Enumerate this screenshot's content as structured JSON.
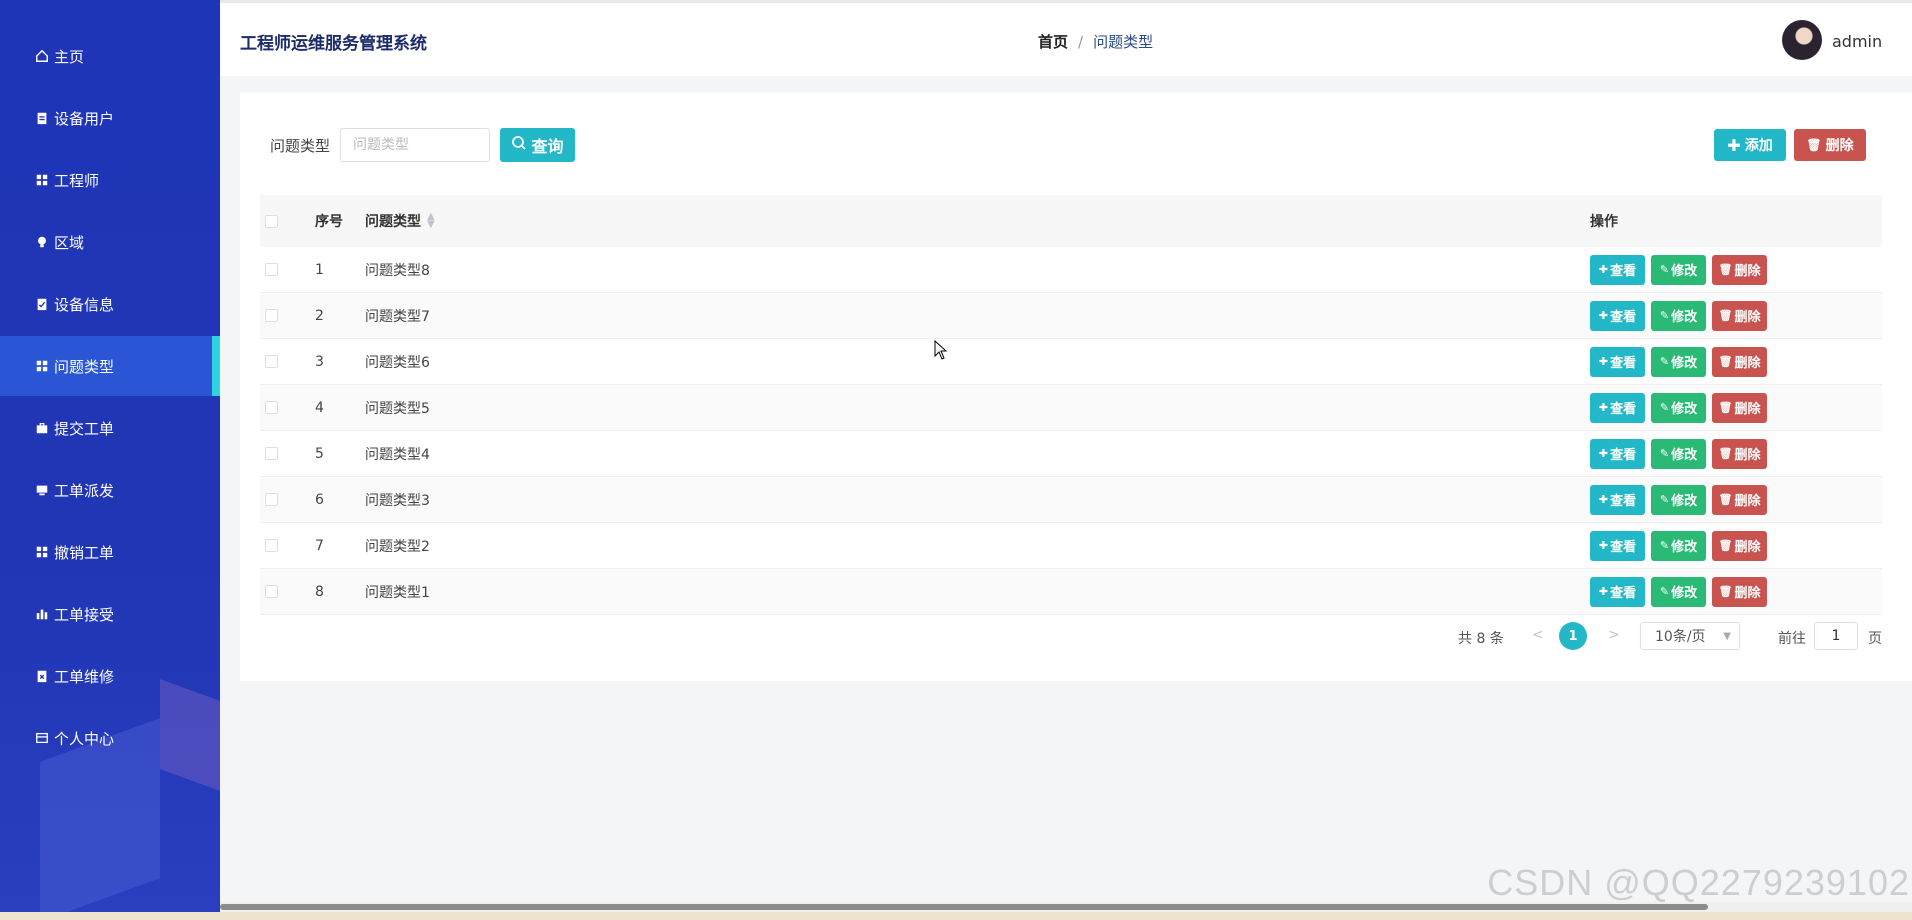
{
  "sidebar": {
    "items": [
      {
        "label": "主页",
        "icon": "home-icon"
      },
      {
        "label": "设备用户",
        "icon": "clipboard-icon"
      },
      {
        "label": "工程师",
        "icon": "grid-icon"
      },
      {
        "label": "区域",
        "icon": "lightbulb-icon"
      },
      {
        "label": "设备信息",
        "icon": "clipboard-check-icon"
      },
      {
        "label": "问题类型",
        "icon": "grid-icon",
        "active": true
      },
      {
        "label": "提交工单",
        "icon": "briefcase-icon"
      },
      {
        "label": "工单派发",
        "icon": "monitor-icon"
      },
      {
        "label": "撤销工单",
        "icon": "grid-icon"
      },
      {
        "label": "工单接受",
        "icon": "bar-chart-icon"
      },
      {
        "label": "工单维修",
        "icon": "clipboard-x-icon"
      },
      {
        "label": "个人中心",
        "icon": "card-icon"
      }
    ]
  },
  "header": {
    "app_title": "工程师运维服务管理系统",
    "breadcrumb_home": "首页",
    "breadcrumb_sep": "/",
    "breadcrumb_current": "问题类型",
    "username": "admin"
  },
  "search": {
    "label": "问题类型",
    "placeholder": "问题类型",
    "value": "",
    "query_label": "查询"
  },
  "toolbar": {
    "add_label": "添加",
    "delete_label": "删除"
  },
  "table": {
    "headers": {
      "index": "序号",
      "type": "问题类型",
      "ops": "操作"
    },
    "rows": [
      {
        "index": "1",
        "type": "问题类型8"
      },
      {
        "index": "2",
        "type": "问题类型7"
      },
      {
        "index": "3",
        "type": "问题类型6"
      },
      {
        "index": "4",
        "type": "问题类型5"
      },
      {
        "index": "5",
        "type": "问题类型4"
      },
      {
        "index": "6",
        "type": "问题类型3"
      },
      {
        "index": "7",
        "type": "问题类型2"
      },
      {
        "index": "8",
        "type": "问题类型1"
      }
    ],
    "row_actions": {
      "view": "查看",
      "edit": "修改",
      "delete": "删除"
    }
  },
  "pagination": {
    "total": "共 8 条",
    "prev": "<",
    "current_page": "1",
    "next": ">",
    "page_size": "10条/页",
    "goto_label": "前往",
    "goto_value": "1",
    "page_suffix": "页"
  },
  "watermark": "CSDN @QQ2279239102",
  "colors": {
    "sidebar": "#1f35b8",
    "active_indicator": "#2fd3e0",
    "primary": "#23b8c8",
    "success": "#2bba76",
    "danger": "#c9544f"
  }
}
